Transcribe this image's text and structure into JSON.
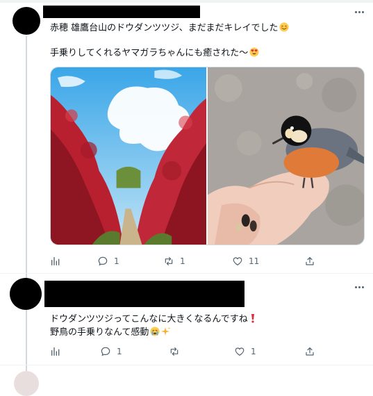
{
  "tweet1": {
    "line1": "赤穂 雄鷹台山のドウダンツツジ、まだまだキレイでした",
    "line2": "手乗りしてくれるヤマガラちゃんにも癒された〜",
    "replies": "1",
    "retweets": "1",
    "likes": "11"
  },
  "tweet2": {
    "line1": "ドウダンツツジってこんなに大きくなるんですね",
    "line2": "野鳥の手乗りなんて感動",
    "replies": "1",
    "retweets": "",
    "likes": "1"
  },
  "icons": {
    "menu": "more-dots-icon",
    "views": "analytics-icon",
    "reply": "reply-icon",
    "retweet": "retweet-icon",
    "like": "heart-icon",
    "share": "share-icon"
  },
  "colors": {
    "icon_gray": "#536471",
    "divider": "#eff3f4",
    "text": "#0f1419"
  }
}
